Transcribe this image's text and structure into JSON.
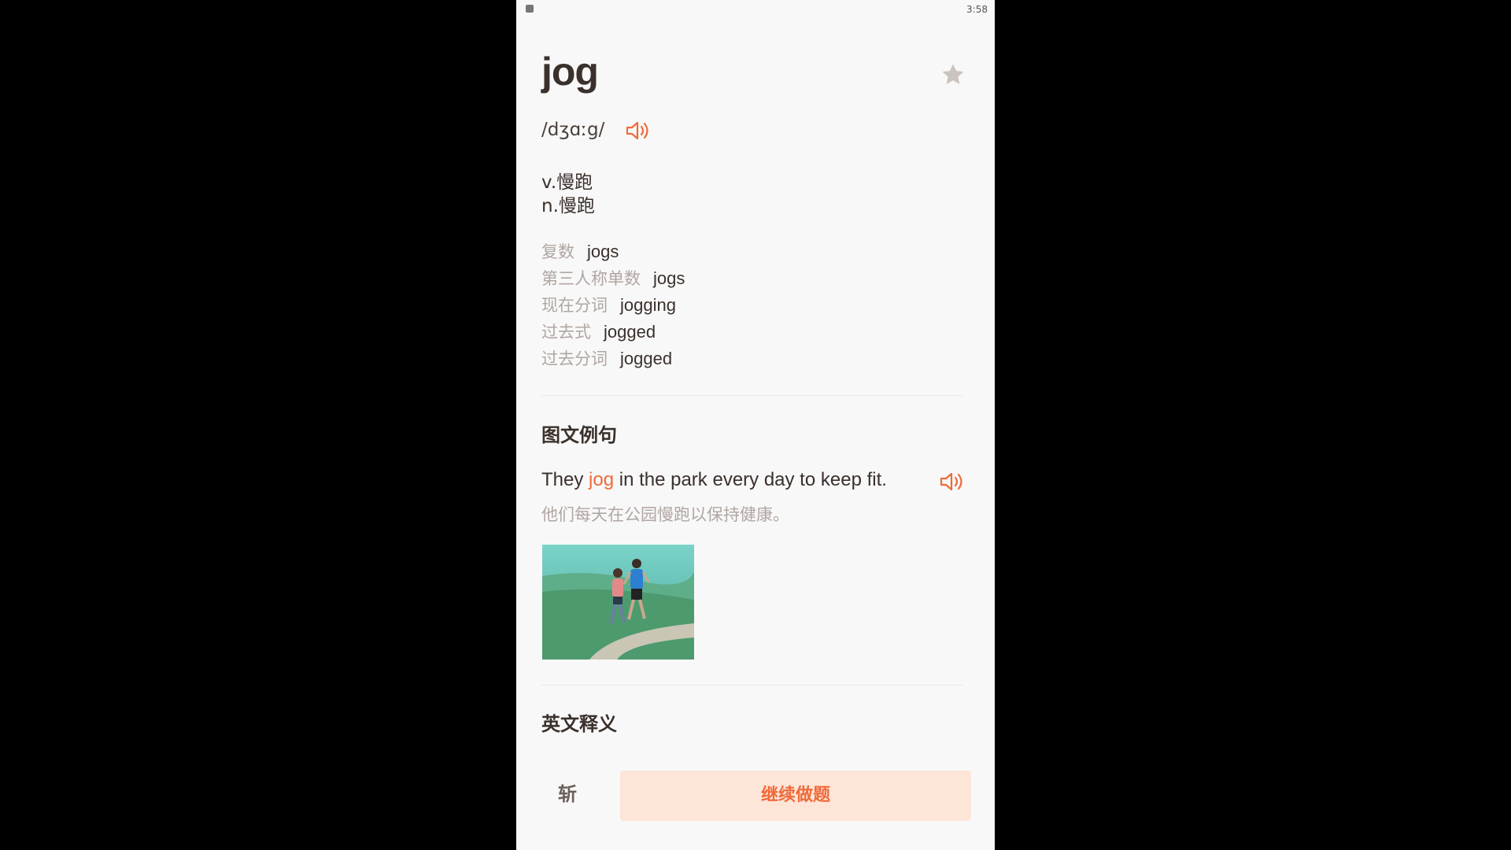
{
  "status_bar": {
    "time": "3:58"
  },
  "word": {
    "headword": "jog",
    "phonetic": "/dʒɑːg/",
    "star_icon": "star-icon",
    "speaker_icon": "speaker-icon"
  },
  "definitions": [
    "v.慢跑",
    "n.慢跑"
  ],
  "forms": [
    {
      "label": "复数",
      "value": "jogs"
    },
    {
      "label": "第三人称单数",
      "value": "jogs"
    },
    {
      "label": "现在分词",
      "value": "jogging"
    },
    {
      "label": "过去式",
      "value": "jogged"
    },
    {
      "label": "过去分词",
      "value": "jogged"
    }
  ],
  "examples_section": {
    "title": "图文例句",
    "sentence_before": "They ",
    "sentence_highlight": "jog",
    "sentence_after": " in the park every day to keep fit.",
    "translation": "他们每天在公园慢跑以保持健康。"
  },
  "english_section": {
    "title": "英文释义"
  },
  "bottom_bar": {
    "kill_label": "斩",
    "continue_label": "继续做题"
  },
  "colors": {
    "accent": "#f06a3a",
    "button_bg": "#fde5d8",
    "background": "#f8f8f8",
    "text": "#3a302c",
    "muted": "#b0a6a2"
  }
}
